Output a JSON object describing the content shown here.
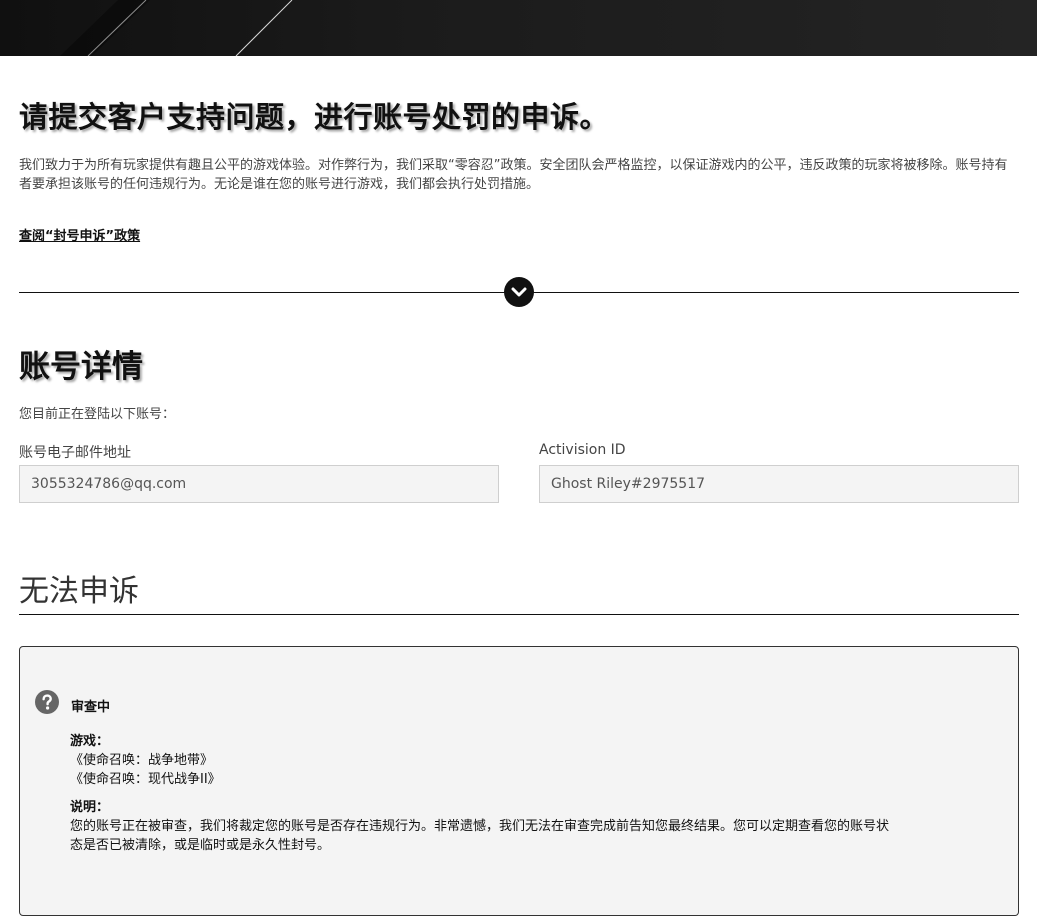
{
  "banner": {
    "background_color": "#151515",
    "stripe_color": "#d9d9d9"
  },
  "page": {
    "title": "请提交客户支持问题，进行账号处罚的申诉。",
    "intro": "我们致力于为所有玩家提供有趣且公平的游戏体验。对作弊行为，我们采取“零容忍”政策。安全团队会严格监控，以保证游戏内的公平，违反政策的玩家将被移除。账号持有者要承担该账号的任何违规行为。无论是谁在您的账号进行游戏，我们都会执行处罚措施。",
    "policy_link": "查阅“封号申诉”政策",
    "expand_icon": "chevron-down-icon"
  },
  "account": {
    "title": "账号详情",
    "signed_in_text": "您目前正在登陆以下账号：",
    "email_label": "账号电子邮件地址",
    "email_value": "3055324786@qq.com",
    "activision_label": "Activision ID",
    "activision_value": "Ghost Riley#2975517"
  },
  "appeal": {
    "title": "无法申诉",
    "status_icon": "question-circle-icon",
    "status": "审查中",
    "games_heading": "游戏：",
    "games": [
      "《使命召唤：战争地带》",
      "《使命召唤：现代战争II》"
    ],
    "description_heading": "说明：",
    "description": "您的账号正在被审查，我们将裁定您的账号是否存在违规行为。非常遗憾，我们无法在审查完成前告知您最终结果。您可以定期查看您的账号状态是否已被清除，或是临时或是永久性封号。"
  }
}
